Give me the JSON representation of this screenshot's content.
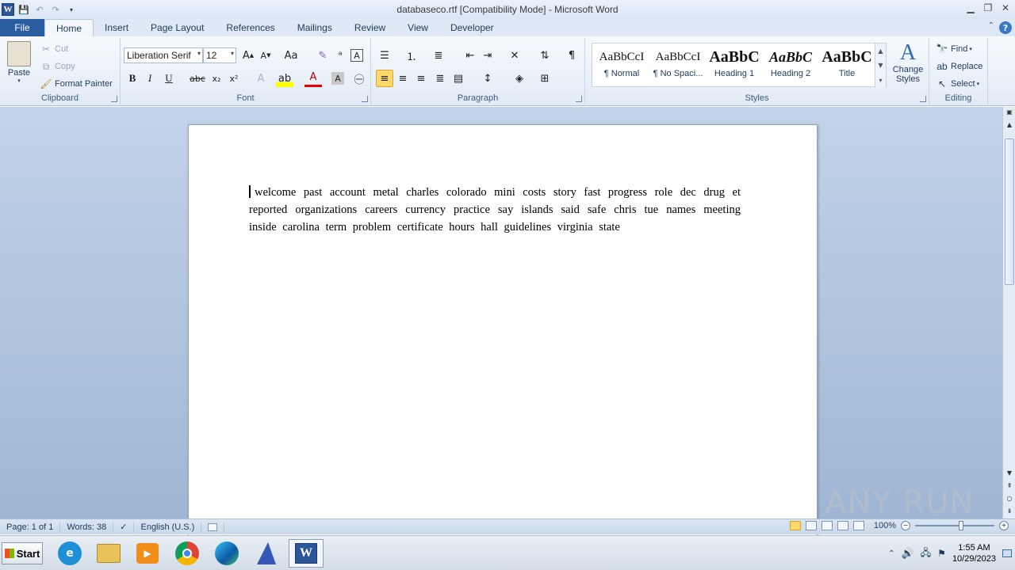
{
  "window": {
    "title": "databaseco.rtf [Compatibility Mode]  -  Microsoft Word"
  },
  "tabs": [
    {
      "label": "File"
    },
    {
      "label": "Home"
    },
    {
      "label": "Insert"
    },
    {
      "label": "Page Layout"
    },
    {
      "label": "References"
    },
    {
      "label": "Mailings"
    },
    {
      "label": "Review"
    },
    {
      "label": "View"
    },
    {
      "label": "Developer"
    }
  ],
  "clipboard": {
    "paste": "Paste",
    "cut": "Cut",
    "copy": "Copy",
    "format_painter": "Format Painter",
    "group_label": "Clipboard"
  },
  "font": {
    "family": "Liberation Serif",
    "size": "12",
    "group_label": "Font"
  },
  "paragraph": {
    "group_label": "Paragraph"
  },
  "styles": {
    "items": [
      {
        "preview": "AaBbCcI",
        "name": "¶ Normal"
      },
      {
        "preview": "AaBbCcI",
        "name": "¶ No Spaci..."
      },
      {
        "preview": "AaBbC",
        "name": "Heading 1"
      },
      {
        "preview": "AaBbC",
        "name": "Heading 2"
      },
      {
        "preview": "AaBbC",
        "name": "Title"
      }
    ],
    "change_styles": "Change Styles",
    "group_label": "Styles"
  },
  "editing": {
    "find": "Find",
    "replace": "Replace",
    "select": "Select",
    "group_label": "Editing"
  },
  "document": {
    "text": "welcome   past account metal    charles   colorado mini costs story fast progress role dec drug et   reported   organizations careers currency practice    say   islands    said safe chris tue names meeting inside      carolina term problem certificate     hours hall guidelines     virginia state"
  },
  "status": {
    "page": "Page: 1 of 1",
    "words": "Words: 38",
    "language": "English (U.S.)",
    "zoom": "100%"
  },
  "taskbar": {
    "start": "Start",
    "time": "1:55 AM",
    "date": "10/29/2023"
  },
  "watermark": "ANY RUN"
}
